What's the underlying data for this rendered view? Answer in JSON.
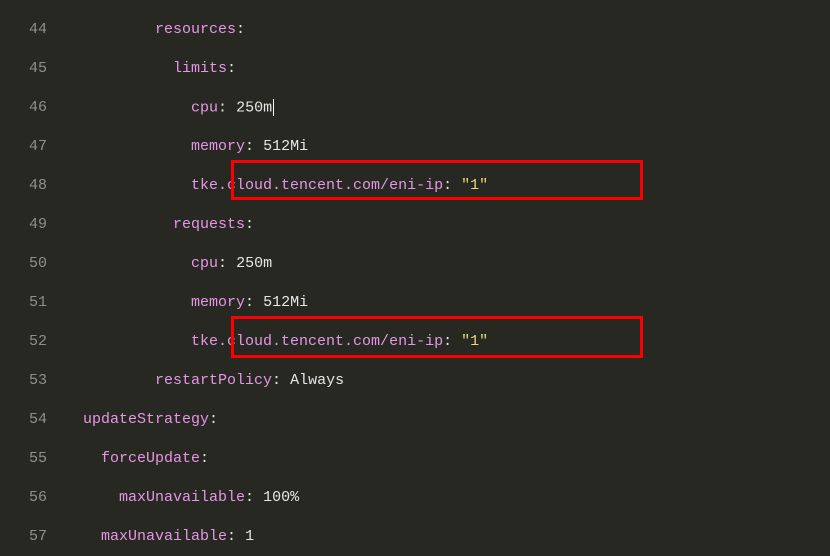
{
  "lines": {
    "44": {
      "indent": "          ",
      "key": "resources",
      "colon": ":"
    },
    "45": {
      "indent": "            ",
      "key": "limits",
      "colon": ":"
    },
    "46": {
      "indent": "              ",
      "key": "cpu",
      "colon": ": ",
      "value": "250m",
      "cursor": true
    },
    "47": {
      "indent": "              ",
      "key": "memory",
      "colon": ": ",
      "value": "512Mi"
    },
    "48": {
      "indent": "              ",
      "key": "tke.cloud.tencent.com/eni-ip",
      "colon": ": ",
      "value": "\"1\"",
      "isString": true
    },
    "49": {
      "indent": "            ",
      "key": "requests",
      "colon": ":"
    },
    "50": {
      "indent": "              ",
      "key": "cpu",
      "colon": ": ",
      "value": "250m"
    },
    "51": {
      "indent": "              ",
      "key": "memory",
      "colon": ": ",
      "value": "512Mi"
    },
    "52": {
      "indent": "              ",
      "key": "tke.cloud.tencent.com/eni-ip",
      "colon": ": ",
      "value": "\"1\"",
      "isString": true
    },
    "53": {
      "indent": "          ",
      "key": "restartPolicy",
      "colon": ": ",
      "value": "Always"
    },
    "54": {
      "indent": "  ",
      "key": "updateStrategy",
      "colon": ":"
    },
    "55": {
      "indent": "    ",
      "key": "forceUpdate",
      "colon": ":"
    },
    "56": {
      "indent": "      ",
      "key": "maxUnavailable",
      "colon": ": ",
      "value": "100%"
    },
    "57": {
      "indent": "    ",
      "key": "maxUnavailable",
      "colon": ": ",
      "value": "1"
    }
  },
  "lineNumbers": [
    "44",
    "45",
    "46",
    "47",
    "48",
    "49",
    "50",
    "51",
    "52",
    "53",
    "54",
    "55",
    "56",
    "57"
  ]
}
